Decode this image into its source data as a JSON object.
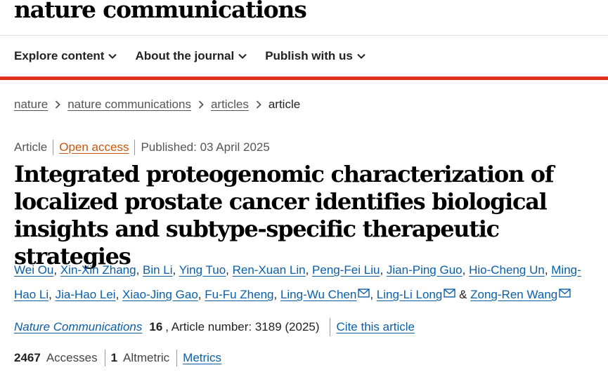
{
  "brand": {
    "title": "nature communications"
  },
  "nav": {
    "items": [
      {
        "label": "Explore content"
      },
      {
        "label": "About the journal"
      },
      {
        "label": "Publish with us"
      }
    ]
  },
  "breadcrumb": {
    "items": [
      "nature",
      "nature communications",
      "articles"
    ],
    "current": "article"
  },
  "meta": {
    "type": "Article",
    "access": "Open access",
    "published": "Published: 03 April 2025"
  },
  "article": {
    "title": "Integrated proteogenomic characterization of localized prostate cancer identifies biological insights and subtype-specific therapeutic strategies"
  },
  "authors": [
    {
      "name": "Wei Ou",
      "sep": ", "
    },
    {
      "name": "Xin-Xin Zhang",
      "sep": ", "
    },
    {
      "name": "Bin Li",
      "sep": ", "
    },
    {
      "name": "Ying Tuo",
      "sep": ", "
    },
    {
      "name": "Ren-Xuan Lin",
      "sep": ", "
    },
    {
      "name": "Peng-Fei Liu",
      "sep": ", "
    },
    {
      "name": "Jian-Ping Guo",
      "sep": ", "
    },
    {
      "name": "Hio-Cheng Un",
      "sep": ", "
    },
    {
      "name": "Ming-Hao Li",
      "sep": ", "
    },
    {
      "name": "Jia-Hao Lei",
      "sep": ", "
    },
    {
      "name": "Xiao-Jing Gao",
      "sep": ", "
    },
    {
      "name": "Fu-Fu Zheng",
      "sep": ", "
    },
    {
      "name": "Ling-Wu Chen",
      "sep": ", ",
      "mail": true
    },
    {
      "name": "Ling-Li Long",
      "sep": " & ",
      "mail": true
    },
    {
      "name": "Zong-Ren Wang",
      "sep": "",
      "mail": true
    }
  ],
  "citation": {
    "journal": "Nature Communications",
    "volume": "16",
    "article_number": ", Article number: 3189 (2025)",
    "cite_label": "Cite this article"
  },
  "metrics": {
    "accesses_value": "2467",
    "accesses_label": "Accesses",
    "altmetric_value": "1",
    "altmetric_label": "Altmetric",
    "metrics_link": "Metrics"
  },
  "colors": {
    "accent_red": "#e0311f",
    "link_blue": "#0b5ea8",
    "open_access_orange": "#c4570e"
  }
}
